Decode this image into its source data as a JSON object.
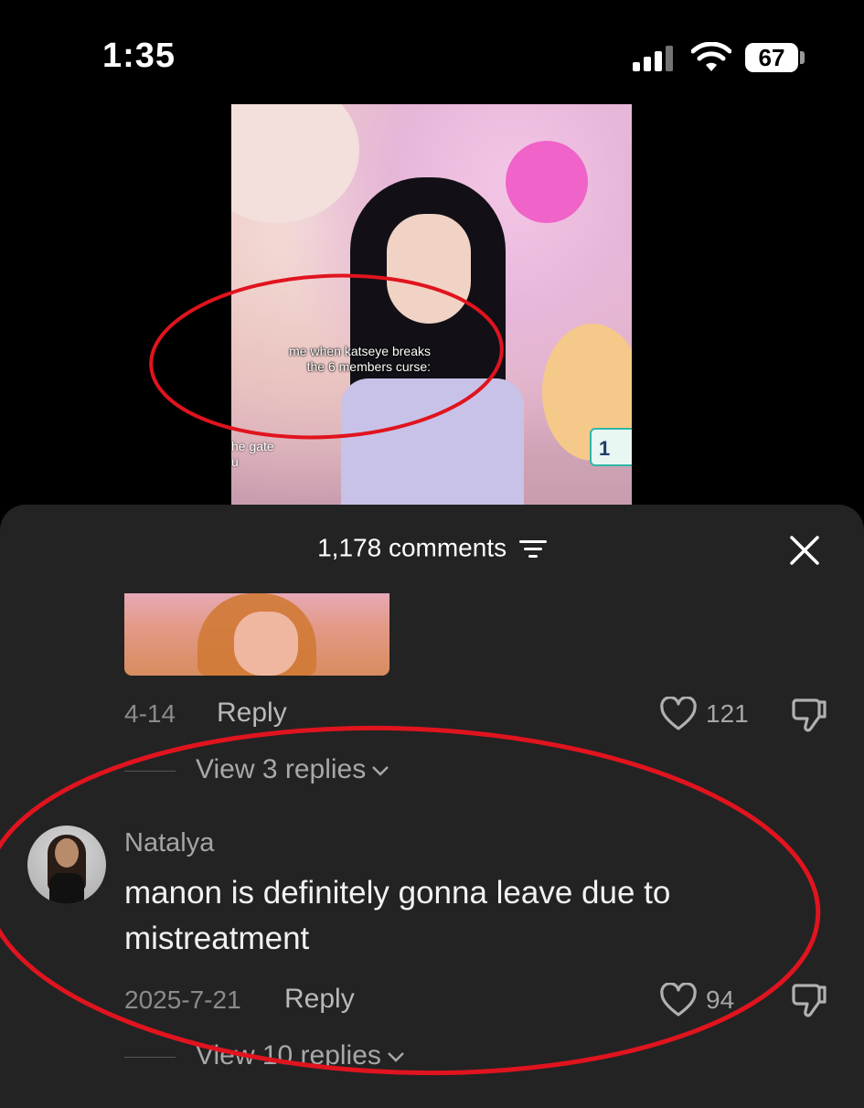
{
  "status_bar": {
    "time": "1:35",
    "battery": "67"
  },
  "video": {
    "caption_line1": "me when katseye breaks",
    "caption_line2": "the 6 members curse:",
    "edge_text_line1": "he gate",
    "edge_text_line2": "u",
    "badge": "1"
  },
  "comments_sheet": {
    "title": "1,178 comments"
  },
  "comments": [
    {
      "date": "4-14",
      "reply_label": "Reply",
      "likes": "121",
      "view_replies": "View 3 replies"
    },
    {
      "author": "Natalya",
      "text": "manon is definitely gonna leave due to mistreatment",
      "date": "2025-7-21",
      "reply_label": "Reply",
      "likes": "94",
      "view_replies": "View 10 replies"
    }
  ],
  "colors": {
    "sheet_bg": "#232324",
    "annotation_red": "#e0141e"
  }
}
